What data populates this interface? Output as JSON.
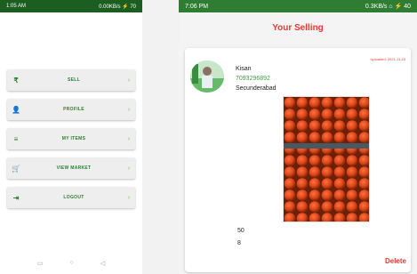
{
  "left_screen": {
    "status": {
      "time": "1:05 AM",
      "right": "0.00KB/s ⚡ 70"
    },
    "menu": [
      {
        "icon": "₹",
        "label": "SELL",
        "icon_name": "rupee-icon"
      },
      {
        "icon": "👤",
        "label": "PROFILE",
        "icon_name": "profile-icon"
      },
      {
        "icon": "≡",
        "label": "MY ITEMS",
        "icon_name": "list-icon"
      },
      {
        "icon": "🛒",
        "label": "VIEW MARKET",
        "icon_name": "cart-icon"
      },
      {
        "icon": "⇥",
        "label": "LOGOUT",
        "icon_name": "logout-icon"
      }
    ],
    "chevron": "›",
    "nav": [
      "▭",
      "○",
      "◁"
    ]
  },
  "right_screen": {
    "status": {
      "time": "7:06 PM",
      "right": "0.3KB/s ⌂ ⚡ 40"
    },
    "title": "Your Selling",
    "card": {
      "date": "Uploaded: 2021-11-23",
      "name": "Kisan",
      "phone": "7093296892",
      "city": "Secunderabad",
      "quantity": "50",
      "price": "8",
      "delete_label": "Delete"
    }
  },
  "colors": {
    "primary_green": "#2e7d32",
    "accent_red": "#e53935"
  }
}
